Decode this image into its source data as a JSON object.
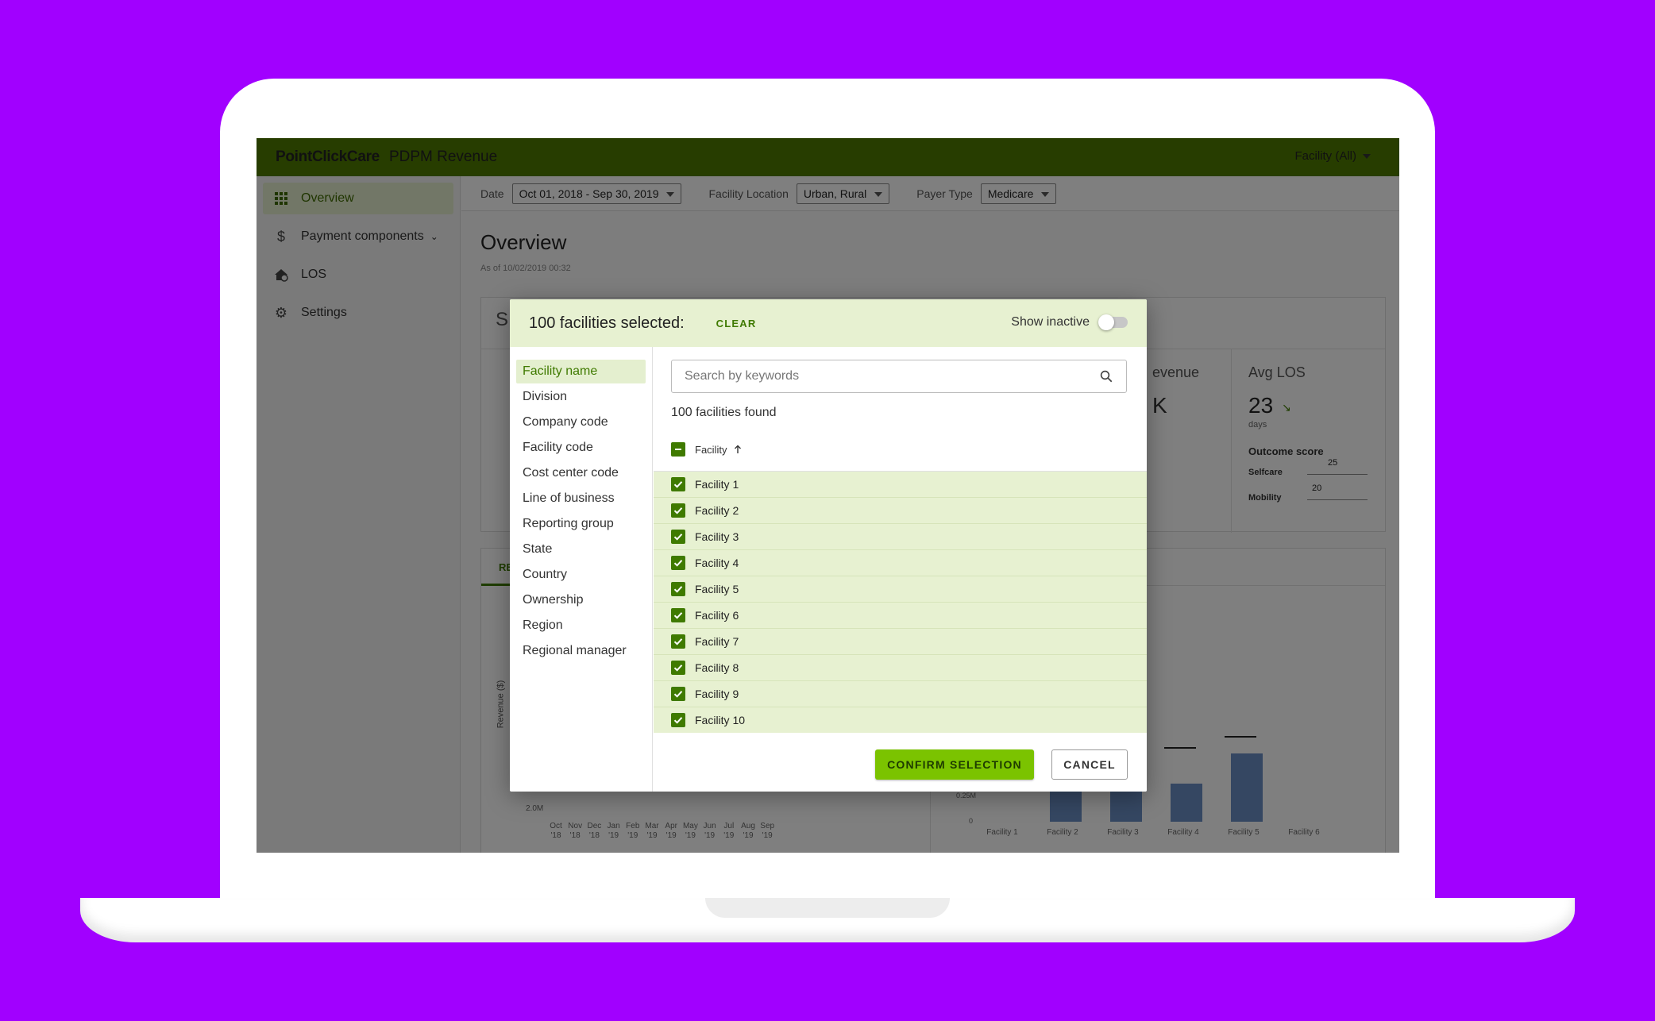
{
  "header": {
    "brand": "PointClickCare",
    "app_title": "PDPM Revenue",
    "facility_filter": "Facility (All)"
  },
  "sidebar": {
    "items": [
      {
        "label": "Overview",
        "icon": "grid-icon",
        "active": true
      },
      {
        "label": "Payment components",
        "icon": "dollar-icon",
        "expandable": true
      },
      {
        "label": "LOS",
        "icon": "house-clock-icon"
      },
      {
        "label": "Settings",
        "icon": "gear-icon"
      }
    ]
  },
  "filters": {
    "date_label": "Date",
    "date_value": "Oct 01, 2018 - Sep 30, 2019",
    "location_label": "Facility Location",
    "location_value": "Urban, Rural",
    "payer_label": "Payer Type",
    "payer_value": "Medicare"
  },
  "page": {
    "title": "Overview",
    "subtitle": "As of 10/02/2019 00:32"
  },
  "background_cards": {
    "card_letter": "S",
    "revenue_fragment": "evenue",
    "revenue_value_fragment": "K",
    "avg_los_title": "Avg LOS",
    "avg_los_value": "23",
    "avg_los_unit": "days",
    "outcome_title": "Outcome score",
    "selfcare_label": "Selfcare",
    "selfcare_value": "25",
    "mobility_label": "Mobility",
    "mobility_value": "20",
    "tab_fragment": "RE",
    "y_axis_label": "Revenue ($)",
    "y_tick_low": "2.0M",
    "right_y_ticks": [
      "0.25M",
      "0"
    ],
    "months": [
      "Oct '18",
      "Nov '18",
      "Dec '18",
      "Jan '19",
      "Feb '19",
      "Mar '19",
      "Apr '19",
      "May '19",
      "Jun '19",
      "Jul '19",
      "Aug '19",
      "Sep '19"
    ],
    "facility_ticks": [
      "Facility 1",
      "Facility 2",
      "Facility 3",
      "Facility 4",
      "Facility 5",
      "Facility 6"
    ]
  },
  "modal": {
    "selected_count": "100 facilities selected:",
    "clear_label": "CLEAR",
    "show_inactive_label": "Show inactive",
    "categories": [
      "Facility name",
      "Division",
      "Company code",
      "Facility code",
      "Cost center code",
      "Line of business",
      "Reporting group",
      "State",
      "Country",
      "Ownership",
      "Region",
      "Regional manager"
    ],
    "search_placeholder": "Search by keywords",
    "found_text": "100 facilities found",
    "column_header": "Facility",
    "rows": [
      "Facility 1",
      "Facility 2",
      "Facility 3",
      "Facility 4",
      "Facility 5",
      "Facility 6",
      "Facility 7",
      "Facility 8",
      "Facility 9",
      "Facility 10"
    ],
    "confirm_label": "CONFIRM SELECTION",
    "cancel_label": "CANCEL"
  },
  "colors": {
    "background": "#a100ff",
    "topbar": "#4e7a00",
    "accent_green": "#3f7a00",
    "confirm_button": "#7bc300",
    "selected_row": "#e7f1d1"
  }
}
